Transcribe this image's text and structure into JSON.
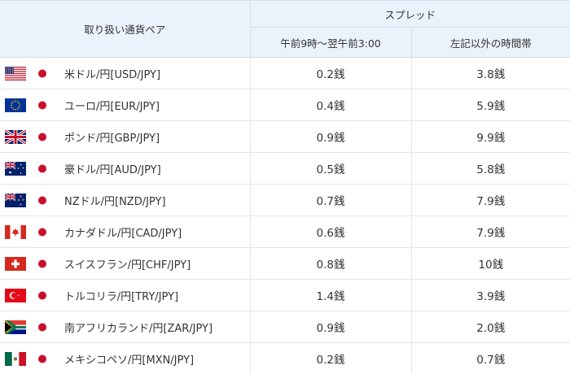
{
  "header": {
    "pair": "取り扱い通貨ペア",
    "spread": "スプレッド",
    "time_a": "午前9時〜翌午前3:00",
    "time_b": "左記以外の時間帯"
  },
  "rows": [
    {
      "flag": "us-flag-icon",
      "pair": "米ドル/円[USD/JPY]",
      "a": "0.2銭",
      "b": "3.8銭"
    },
    {
      "flag": "eu-flag-icon",
      "pair": "ユーロ/円[EUR/JPY]",
      "a": "0.4銭",
      "b": "5.9銭"
    },
    {
      "flag": "uk-flag-icon",
      "pair": "ポンド/円[GBP/JPY]",
      "a": "0.9銭",
      "b": "9.9銭"
    },
    {
      "flag": "au-flag-icon",
      "pair": "豪ドル/円[AUD/JPY]",
      "a": "0.5銭",
      "b": "5.8銭"
    },
    {
      "flag": "nz-flag-icon",
      "pair": "NZドル/円[NZD/JPY]",
      "a": "0.7銭",
      "b": "7.9銭"
    },
    {
      "flag": "ca-flag-icon",
      "pair": "カナダドル/円[CAD/JPY]",
      "a": "0.6銭",
      "b": "7.9銭"
    },
    {
      "flag": "ch-flag-icon",
      "pair": "スイスフラン/円[CHF/JPY]",
      "a": "0.8銭",
      "b": "10銭"
    },
    {
      "flag": "tr-flag-icon",
      "pair": "トルコリラ/円[TRY/JPY]",
      "a": "1.4銭",
      "b": "3.9銭"
    },
    {
      "flag": "za-flag-icon",
      "pair": "南アフリカランド/円[ZAR/JPY]",
      "a": "0.9銭",
      "b": "2.0銭"
    },
    {
      "flag": "mx-flag-icon",
      "pair": "メキシコペソ/円[MXN/JPY]",
      "a": "0.2銭",
      "b": "0.7銭"
    }
  ],
  "quote_flag": "jp-flag-icon",
  "colors": {
    "header_bg": "#eaf3fb",
    "border": "#d7dde4",
    "text": "#333333"
  }
}
